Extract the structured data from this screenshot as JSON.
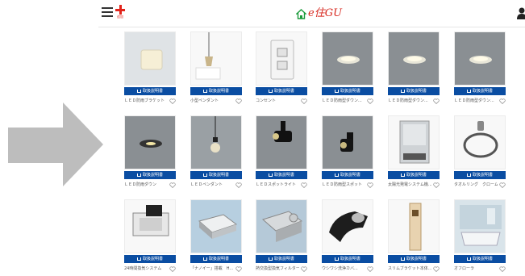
{
  "header": {
    "cross_sub": "追加",
    "logo_text": "e住GU"
  },
  "catalog_button_label": "取扱説明書",
  "products": [
    {
      "name": "ＬＥＤ防雨ブラケット"
    },
    {
      "name": "小型ペンダント"
    },
    {
      "name": "コンセント"
    },
    {
      "name": "ＬＥＤ防雨型ダウン..."
    },
    {
      "name": "ＬＥＤ防雨型ダウン..."
    },
    {
      "name": "ＬＥＤ防雨型ダウン..."
    },
    {
      "name": "ＬＥＤ防雨ダウン"
    },
    {
      "name": "ＬＥＤペンダント"
    },
    {
      "name": "ＬＥＤスポットライト"
    },
    {
      "name": "ＬＥＤ防雨型スポット"
    },
    {
      "name": "太陽光発電システム機..."
    },
    {
      "name": "タオルリング　クローム"
    },
    {
      "name": "24時間換気システム"
    },
    {
      "name": "「ナノイー」搭載　H..."
    },
    {
      "name": "熱交換型換気フィルター..."
    },
    {
      "name": "ウシワシ洗浄カバ..."
    },
    {
      "name": "スリムブラケット本体..."
    },
    {
      "name": "オフローラ"
    }
  ],
  "colors": {
    "accent": "#0a4da2",
    "brand": "#d7271e",
    "arrow": "#bdbdbd"
  }
}
